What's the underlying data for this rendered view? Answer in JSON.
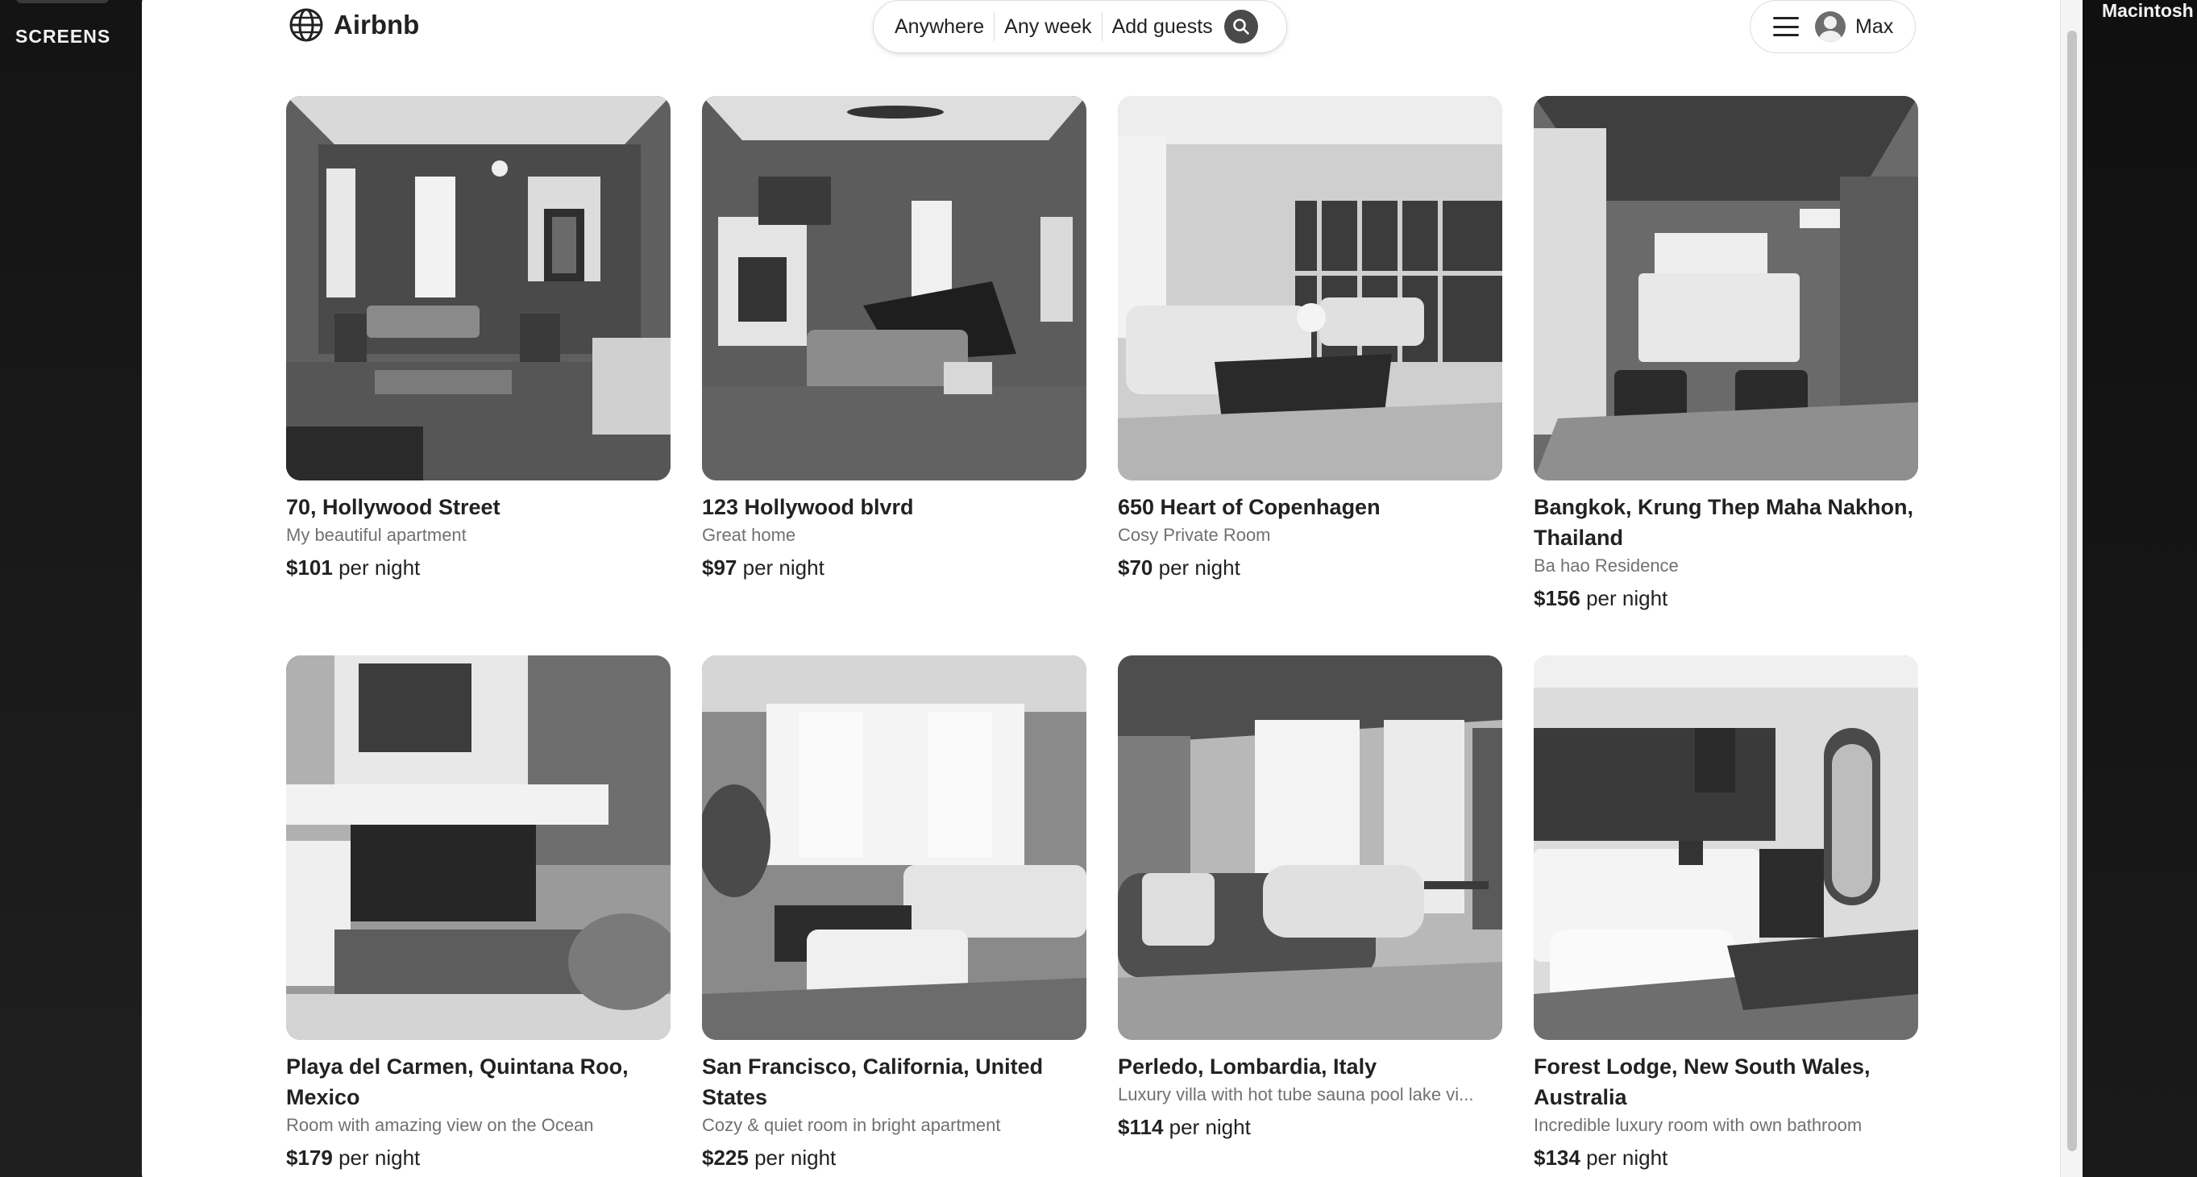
{
  "desktop": {
    "left_label": "SCREENS",
    "right_label": "Macintosh"
  },
  "header": {
    "logo_text": "Airbnb",
    "search": {
      "where": "Anywhere",
      "when": "Any week",
      "who": "Add guests"
    },
    "user_name": "Max"
  },
  "listings": [
    {
      "title": "70, Hollywood Street",
      "subtitle": "My beautiful apartment",
      "price": "$101",
      "price_suffix": "per night"
    },
    {
      "title": "123 Hollywood blvrd",
      "subtitle": "Great home",
      "price": "$97",
      "price_suffix": "per night"
    },
    {
      "title": "650 Heart of Copenhagen",
      "subtitle": "Cosy Private Room",
      "price": "$70",
      "price_suffix": "per night"
    },
    {
      "title": "Bangkok, Krung Thep Maha Nakhon, Thailand",
      "subtitle": "Ba hao Residence",
      "price": "$156",
      "price_suffix": "per night"
    },
    {
      "title": "Playa del Carmen, Quintana Roo, Mexico",
      "subtitle": "Room with amazing view on the Ocean",
      "price": "$179",
      "price_suffix": "per night"
    },
    {
      "title": "San Francisco, California, United States",
      "subtitle": "Cozy & quiet room in bright apartment",
      "price": "$225",
      "price_suffix": "per night"
    },
    {
      "title": "Perledo, Lombardia, Italy",
      "subtitle": "Luxury villa with hot tube sauna pool lake vi...",
      "price": "$114",
      "price_suffix": "per night"
    },
    {
      "title": "Forest Lodge, New South Wales, Australia",
      "subtitle": "Incredible luxury room with own bathroom",
      "price": "$134",
      "price_suffix": "per night"
    }
  ]
}
